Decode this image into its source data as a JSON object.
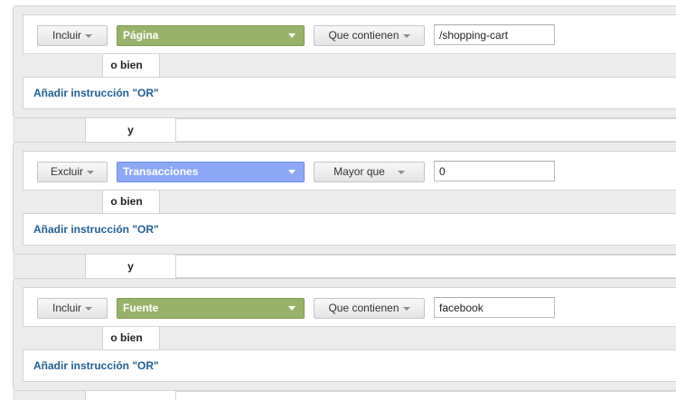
{
  "groups": [
    {
      "type": "Incluir",
      "dimension": "Página",
      "dimension_color": "#97b26a",
      "operator": "Que contienen",
      "value": "/shopping-cart",
      "or_label": "o bien",
      "add_or": "Añadir instrucción \"OR\""
    },
    {
      "type": "Excluir",
      "dimension": "Transacciones",
      "dimension_color": "#8da8f5",
      "operator": "Mayor que",
      "value": "0",
      "or_label": "o bien",
      "add_or": "Añadir instrucción \"OR\""
    },
    {
      "type": "Incluir",
      "dimension": "Fuente",
      "dimension_color": "#97b26a",
      "operator": "Que contienen",
      "value": "facebook",
      "or_label": "o bien",
      "add_or": "Añadir instrucción \"OR\""
    }
  ],
  "and_label": "y",
  "colors": {
    "link": "#1f5f97",
    "panel": "#ececec",
    "border": "#d3d3d3"
  }
}
